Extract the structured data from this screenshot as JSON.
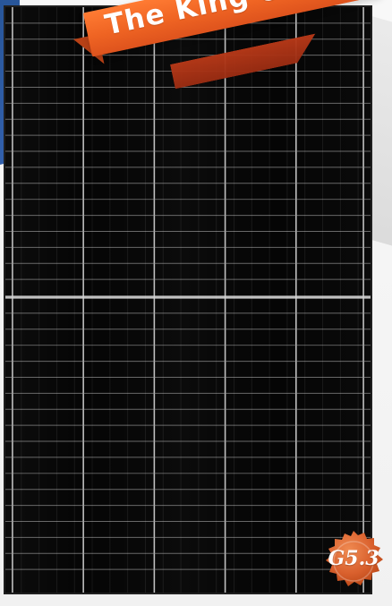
{
  "banner": {
    "text": "The King of Roofto"
  },
  "badge": {
    "text": "G5.3"
  },
  "colors": {
    "blue_accent": "#2a5aa9",
    "ribbon_orange": "#ef6423",
    "ribbon_dark": "#9a2c12",
    "badge_orange": "#d9602d",
    "panel_black": "#050505",
    "panel_line": "#d9d9d9"
  }
}
